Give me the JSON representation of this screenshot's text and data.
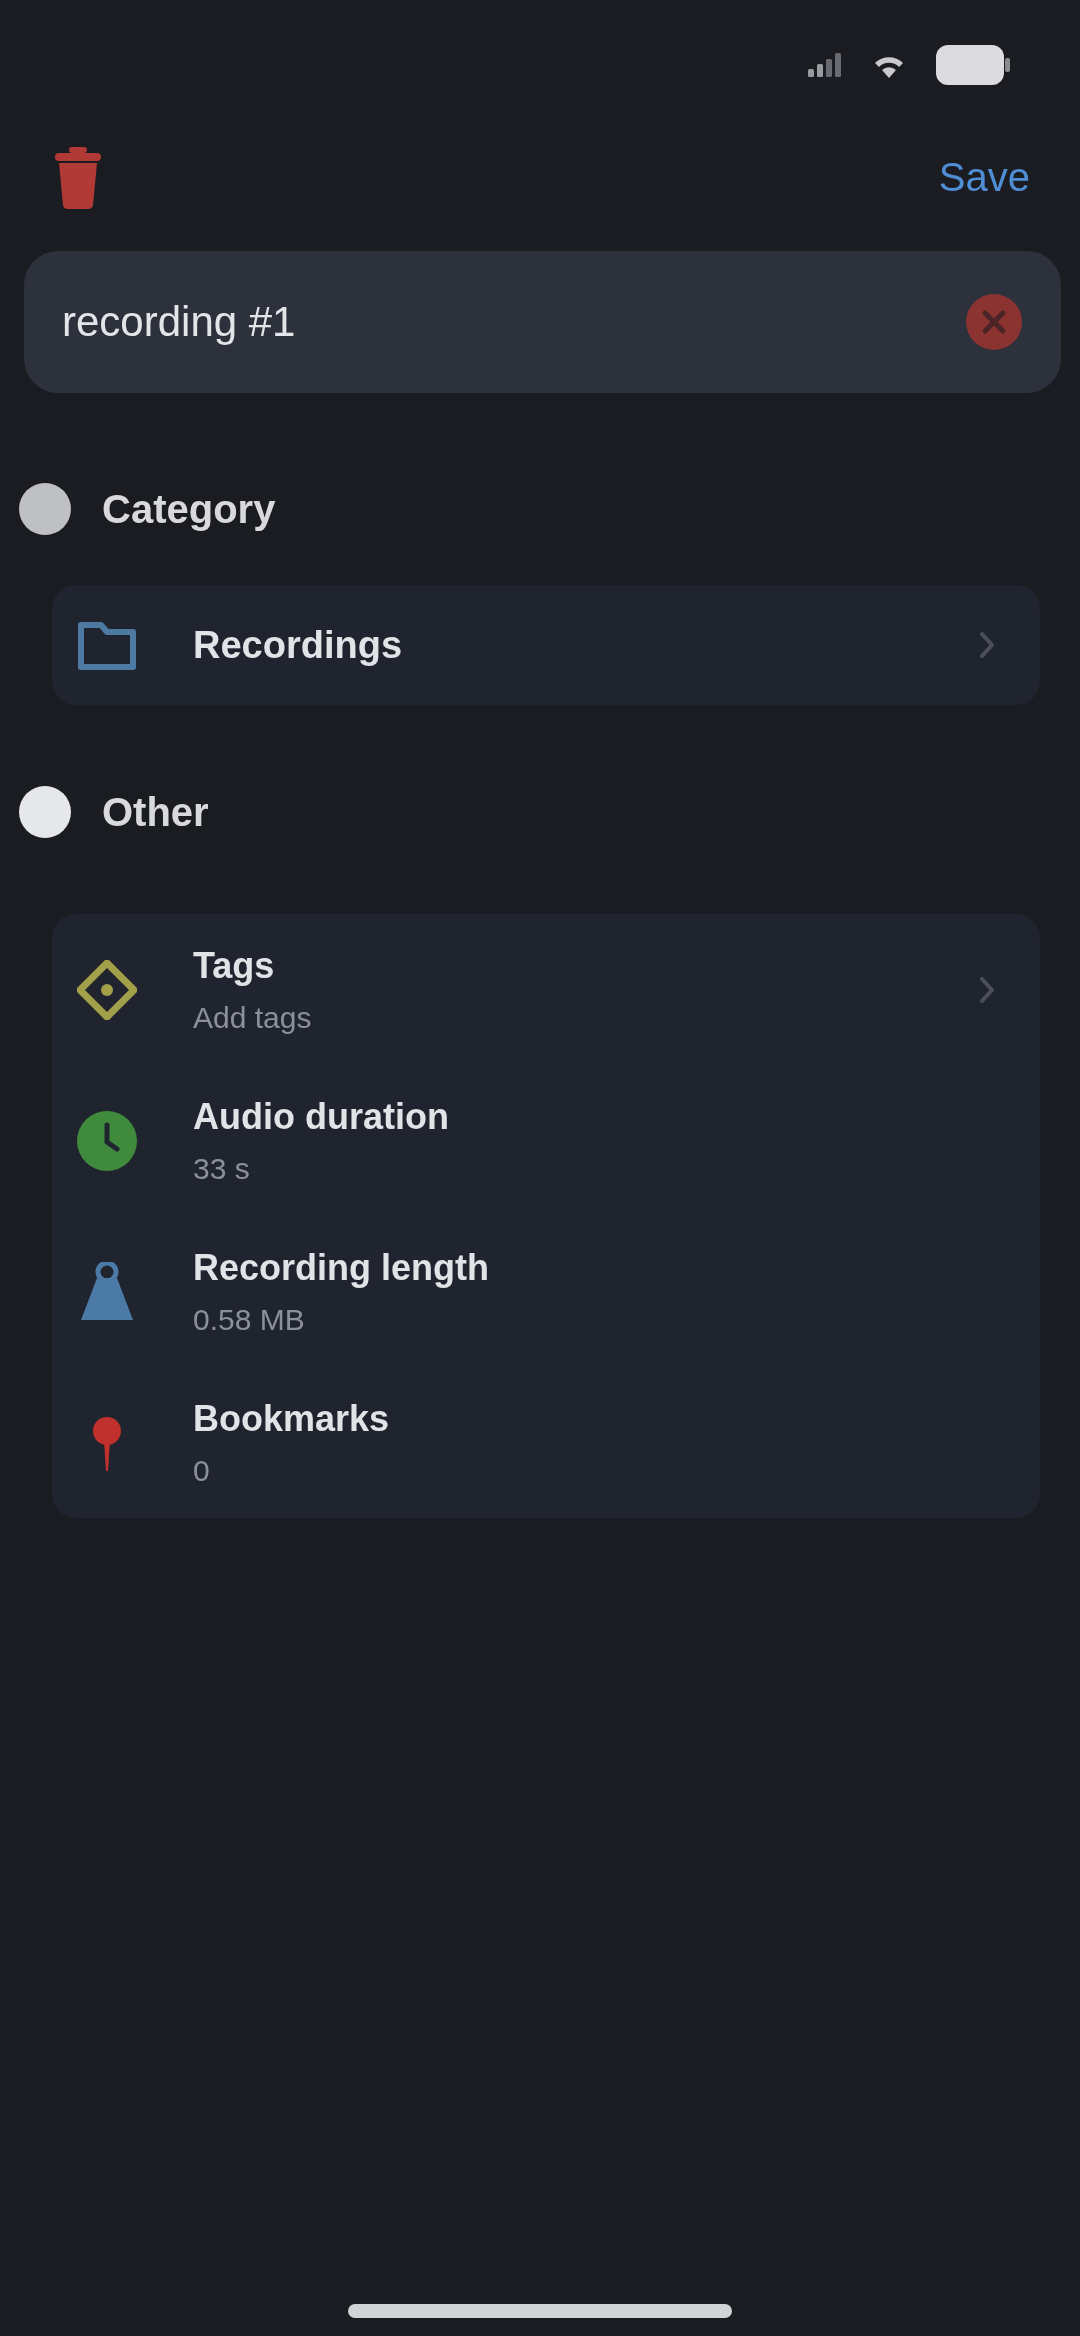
{
  "toolbar": {
    "save": "Save"
  },
  "title_field": {
    "value": "recording #1"
  },
  "sections": [
    {
      "title": "Category",
      "rows": [
        {
          "kind": "folder",
          "label": "Recordings",
          "chevron": true,
          "color": "#4d7aa3"
        }
      ]
    },
    {
      "title": "Other",
      "rows": [
        {
          "kind": "tag",
          "label": "Tags",
          "value": "Add tags",
          "chevron": true,
          "color": "#a3a04a"
        },
        {
          "kind": "clock",
          "label": "Audio duration",
          "value": "33 s",
          "chevron": false,
          "color": "#3f8a3c"
        },
        {
          "kind": "weight",
          "label": "Recording length",
          "value": "0.58 MB",
          "chevron": false,
          "color": "#4b7aa6"
        },
        {
          "kind": "pin",
          "label": "Bookmarks",
          "value": "0",
          "chevron": false,
          "color": "#c0302c"
        }
      ]
    }
  ]
}
